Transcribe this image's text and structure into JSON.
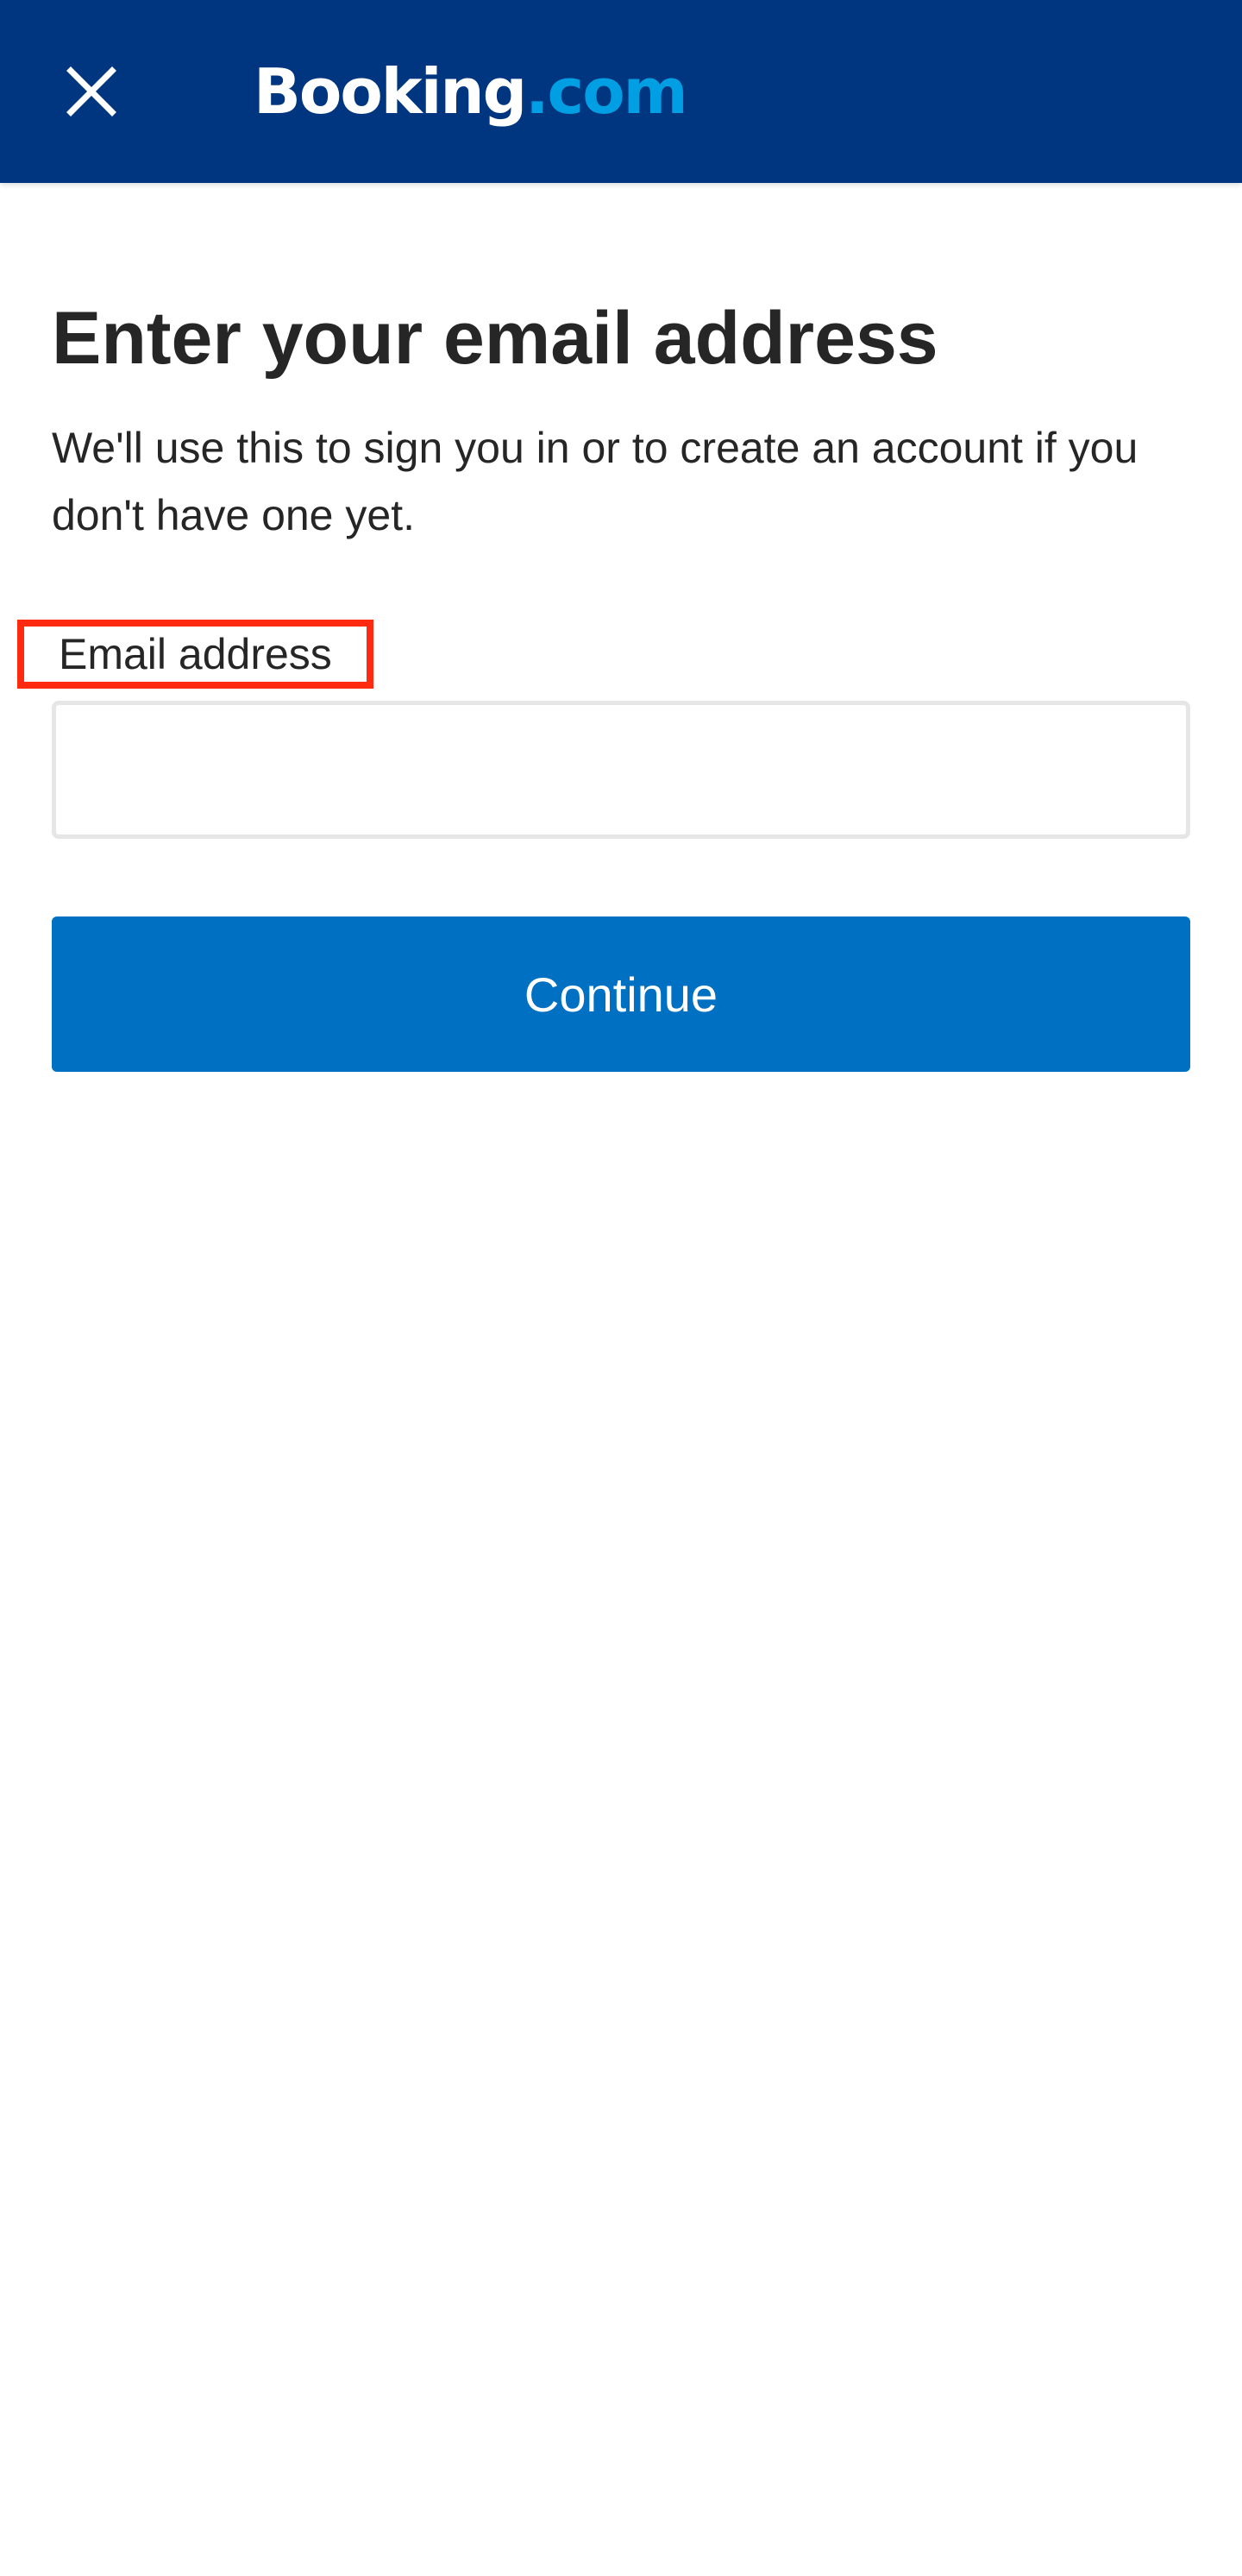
{
  "header": {
    "close_icon": "close-icon",
    "logo_brand": "Booking",
    "logo_tld": ".com",
    "background_color": "#003580",
    "logo_accent_color": "#009fe3"
  },
  "main": {
    "title": "Enter your email address",
    "subtitle": "We'll use this to sign you in or to create an account if you don't have one yet.",
    "email_label": "Email address",
    "email_value": "",
    "email_placeholder": "",
    "continue_label": "Continue",
    "continue_color": "#0071c2",
    "highlight_color": "#ff2a0f"
  }
}
